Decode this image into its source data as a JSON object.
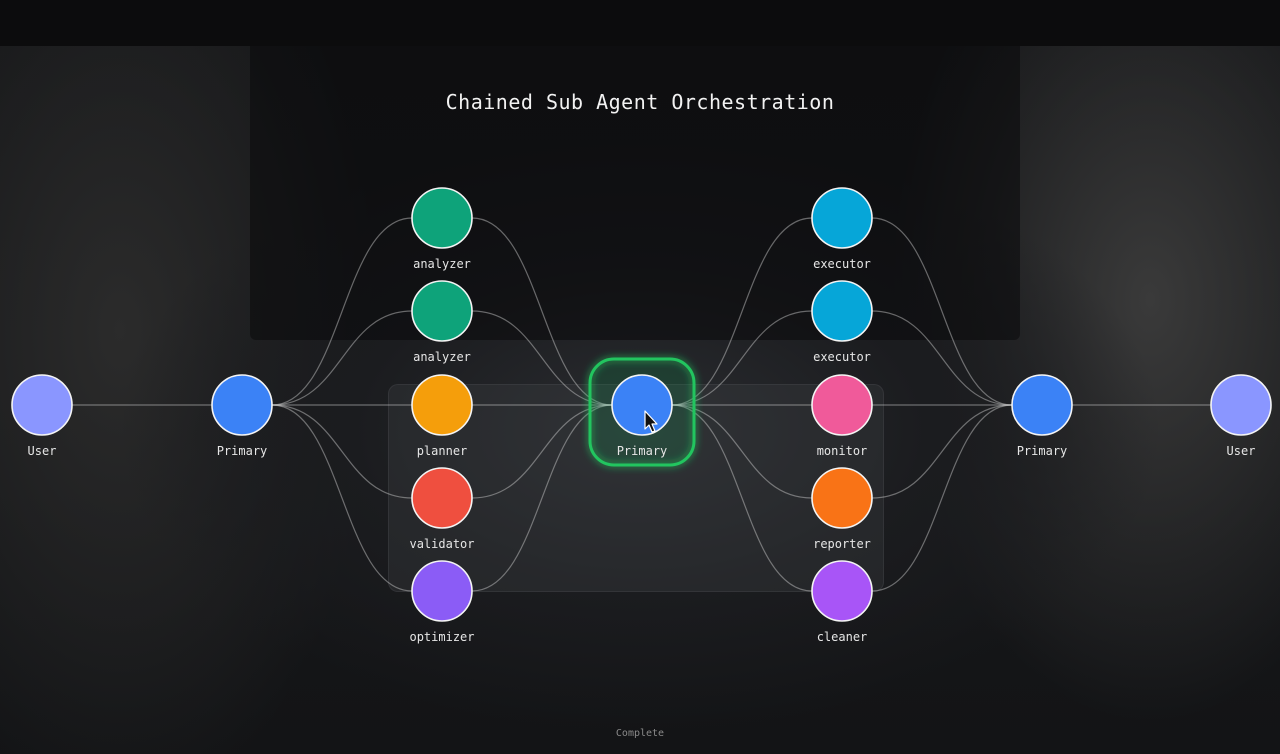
{
  "title": "Chained Sub Agent Orchestration",
  "status": "Complete",
  "colors": {
    "user": "#8a96ff",
    "primary": "#3b82f6",
    "analyzer": "#0ea37a",
    "planner": "#f59e0b",
    "validator": "#ef4f3f",
    "optimizer": "#8b5cf6",
    "executor": "#06a6d8",
    "monitor": "#f05a9a",
    "reporter": "#f97316",
    "cleaner": "#a855f7",
    "highlight": "#22c55e"
  },
  "nodes": [
    {
      "id": "user-left",
      "label": "User",
      "color_key": "user"
    },
    {
      "id": "primary-left",
      "label": "Primary",
      "color_key": "primary"
    },
    {
      "id": "analyzer-1",
      "label": "analyzer",
      "color_key": "analyzer"
    },
    {
      "id": "analyzer-2",
      "label": "analyzer",
      "color_key": "analyzer"
    },
    {
      "id": "planner",
      "label": "planner",
      "color_key": "planner"
    },
    {
      "id": "validator",
      "label": "validator",
      "color_key": "validator"
    },
    {
      "id": "optimizer",
      "label": "optimizer",
      "color_key": "optimizer"
    },
    {
      "id": "primary-center",
      "label": "Primary",
      "color_key": "primary",
      "active": true
    },
    {
      "id": "executor-1",
      "label": "executor",
      "color_key": "executor"
    },
    {
      "id": "executor-2",
      "label": "executor",
      "color_key": "executor"
    },
    {
      "id": "monitor",
      "label": "monitor",
      "color_key": "monitor"
    },
    {
      "id": "reporter",
      "label": "reporter",
      "color_key": "reporter"
    },
    {
      "id": "cleaner",
      "label": "cleaner",
      "color_key": "cleaner"
    },
    {
      "id": "primary-right",
      "label": "Primary",
      "color_key": "primary"
    },
    {
      "id": "user-right",
      "label": "User",
      "color_key": "user"
    }
  ],
  "edges": [
    [
      "user-left",
      "primary-left"
    ],
    [
      "primary-left",
      "analyzer-1"
    ],
    [
      "primary-left",
      "analyzer-2"
    ],
    [
      "primary-left",
      "planner"
    ],
    [
      "primary-left",
      "validator"
    ],
    [
      "primary-left",
      "optimizer"
    ],
    [
      "analyzer-1",
      "primary-center"
    ],
    [
      "analyzer-2",
      "primary-center"
    ],
    [
      "planner",
      "primary-center"
    ],
    [
      "validator",
      "primary-center"
    ],
    [
      "optimizer",
      "primary-center"
    ],
    [
      "primary-center",
      "executor-1"
    ],
    [
      "primary-center",
      "executor-2"
    ],
    [
      "primary-center",
      "monitor"
    ],
    [
      "primary-center",
      "reporter"
    ],
    [
      "primary-center",
      "cleaner"
    ],
    [
      "executor-1",
      "primary-right"
    ],
    [
      "executor-2",
      "primary-right"
    ],
    [
      "monitor",
      "primary-right"
    ],
    [
      "reporter",
      "primary-right"
    ],
    [
      "cleaner",
      "primary-right"
    ],
    [
      "primary-right",
      "user-right"
    ]
  ]
}
